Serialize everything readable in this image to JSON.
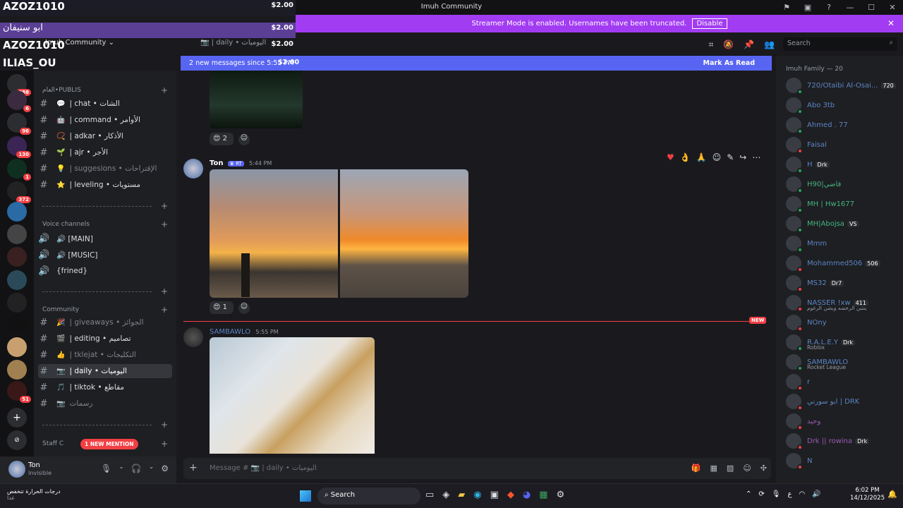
{
  "app": {
    "title": "Imuh Community"
  },
  "banner": {
    "text": "Streamer Mode is enabled. Usernames have been truncated.",
    "button": "Disable"
  },
  "overlay": [
    {
      "name": "AZOZ1010",
      "amount": "$2.00"
    },
    {
      "name": "ابو سنيفان",
      "amount": "$2.00"
    },
    {
      "name": "AZOZ1010",
      "amount": "$2.00"
    },
    {
      "name": "ILIAS_OU",
      "amount": "$2.00"
    }
  ],
  "server": {
    "name": "Imuh Community",
    "channel": "daily • اليوميات"
  },
  "guild_badges": [
    "288",
    "6",
    "96",
    "130",
    "1",
    "372",
    "51"
  ],
  "categories": {
    "publis": "العام•PUBLIS",
    "voice": "Voice channels",
    "community": "Community",
    "staff": "Staff C"
  },
  "channels_public": [
    {
      "emoji": "💬",
      "label": "| chat • الشات"
    },
    {
      "emoji": "🤖",
      "label": "| command • الأوامر"
    },
    {
      "emoji": "📿",
      "label": "| adkar • الأذكار"
    },
    {
      "emoji": "🌱",
      "label": "| ajr • الأجر"
    },
    {
      "emoji": "💡",
      "label": "| suggesions • الإقتراحات"
    },
    {
      "emoji": "⭐",
      "label": "| leveling • مستويات"
    }
  ],
  "channels_voice": [
    {
      "label": "🔊 [MAIN]"
    },
    {
      "label": "🔊 [MUSIC]"
    },
    {
      "label": "{frined}"
    }
  ],
  "channels_community": [
    {
      "emoji": "🎉",
      "label": "| giveaways • الجوائز"
    },
    {
      "emoji": "🎬",
      "label": "| editing • تصاميم"
    },
    {
      "emoji": "👍",
      "label": "| tklejat • التكليجات"
    },
    {
      "emoji": "📷",
      "label": "| daily • اليوميات"
    },
    {
      "emoji": "🎵",
      "label": "| tiktok • مقاطع"
    },
    {
      "emoji": "📷",
      "label": "رسمات"
    }
  ],
  "mention_badge": "1 NEW MENTION",
  "user": {
    "name": "Ton",
    "status": "Invisible"
  },
  "new_messages": {
    "text": "2 new messages since 5:55 PM",
    "amount": "$2.00",
    "action": "Mark As Read"
  },
  "messages": [
    {
      "author": "Ton",
      "tag": "RT",
      "time": "5:44 PM",
      "reaction_count": "1"
    },
    {
      "author": "SAMBAWLO",
      "time": "5:55 PM"
    }
  ],
  "earlier_reaction_count": "2",
  "new_divider": "NEW",
  "input_placeholder": "Message # 📷 | daily • اليوميات",
  "search_placeholder": "Search",
  "members_header": "Imuh Family — 20",
  "members": [
    {
      "name": "720/Otaibi Al-Osai...",
      "tag": "720",
      "color": "#5b84c4",
      "status": "#23a55a"
    },
    {
      "name": "Abo 3tb",
      "color": "#5b84c4",
      "status": "#23a55a"
    },
    {
      "name": "Ahmed . 77",
      "color": "#5b84c4",
      "status": "#23a55a"
    },
    {
      "name": "Faisal",
      "color": "#5b84c4",
      "status": "#f23f43"
    },
    {
      "name": "H",
      "tag": "Drk",
      "color": "#5b84c4",
      "status": "#23a55a"
    },
    {
      "name": "H90|فاضي",
      "color": "#43b581",
      "status": "#23a55a"
    },
    {
      "name": "MH | Hw1677",
      "color": "#43b581",
      "status": "#23a55a"
    },
    {
      "name": "MH|Abojsa",
      "tag": "VS",
      "color": "#43b581",
      "status": "#23a55a"
    },
    {
      "name": "Mmm",
      "color": "#5b84c4",
      "status": "#23a55a"
    },
    {
      "name": "Mohammed506",
      "tag": "506",
      "color": "#5b84c4",
      "status": "#f23f43"
    },
    {
      "name": "MS32",
      "tag": "Dr7",
      "color": "#5b84c4",
      "status": "#f23f43"
    },
    {
      "name": "NASSER !xw",
      "tag": "411",
      "sub": "ينتبن الرخصه وبشن الرغوم",
      "color": "#5b84c4",
      "status": "#f23f43"
    },
    {
      "name": "NOny",
      "color": "#5b84c4",
      "status": "#f23f43"
    },
    {
      "name": "R.A.L.E.Y",
      "tag": "Drk",
      "sub": "Roblox",
      "color": "#5b84c4",
      "status": "#23a55a"
    },
    {
      "name": "SAMBAWLO",
      "sub": "Rocket League",
      "color": "#5b84c4",
      "status": "#23a55a"
    },
    {
      "name": "r",
      "color": "#5b84c4",
      "status": "#f23f43"
    },
    {
      "name": "ابو سورني | DRK",
      "color": "#5b84c4",
      "status": "#f23f43"
    },
    {
      "name": "وحيد",
      "color": "#9b59b6",
      "status": "#f23f43"
    },
    {
      "name": "Drk || rowina",
      "tag": "Drk",
      "color": "#9b59b6",
      "status": "#f23f43"
    },
    {
      "name": "N",
      "color": "#5b84c4",
      "status": "#f23f43"
    }
  ],
  "taskbar": {
    "search": "Search",
    "time": "6:02 PM",
    "date": "14/12/2025",
    "weather": "درجات الحرارة تنخفض",
    "weather_sub": "غدا"
  }
}
